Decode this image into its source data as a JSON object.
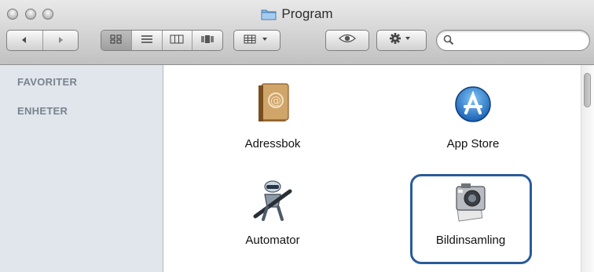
{
  "window": {
    "title": "Program",
    "title_icon": "folder-icon"
  },
  "toolbar": {
    "back_icon": "chevron-left-icon",
    "forward_icon": "chevron-right-icon",
    "view_icons": [
      "icon-view-icon",
      "list-view-icon",
      "column-view-icon",
      "cover-flow-icon"
    ],
    "arrange_icon": "arrange-grid-icon",
    "quicklook_icon": "eye-icon",
    "action_icon": "gear-icon",
    "search": {
      "value": "",
      "placeholder": ""
    }
  },
  "sidebar": {
    "sections": [
      "FAVORITER",
      "ENHETER"
    ]
  },
  "content": {
    "items": [
      {
        "label": "Adressbok",
        "icon": "address-book-icon"
      },
      {
        "label": "App Store",
        "icon": "app-store-icon"
      },
      {
        "label": "Automator",
        "icon": "automator-robot-icon"
      },
      {
        "label": "Bildinsamling",
        "icon": "image-capture-camera-icon",
        "selected": true
      }
    ]
  },
  "colors": {
    "sidebar_bg": "#e1e6ed",
    "sidebar_heading": "#7b828c",
    "selection_border": "#2a5b9a"
  }
}
